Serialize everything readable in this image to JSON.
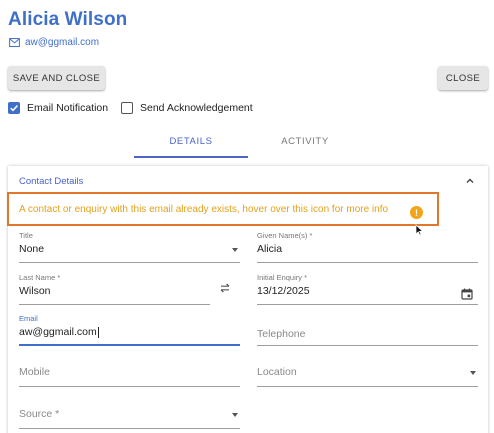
{
  "contact": {
    "name": "Alicia Wilson",
    "email": "aw@ggmail.com"
  },
  "toolbar": {
    "save_close_label": "SAVE AND CLOSE",
    "close_label": "CLOSE"
  },
  "options": {
    "email_notification_label": "Email Notification",
    "email_notification_checked": true,
    "send_ack_label": "Send Acknowledgement",
    "send_ack_checked": false
  },
  "tabs": [
    {
      "label": "DETAILS",
      "active": true
    },
    {
      "label": "ACTIVITY",
      "active": false
    }
  ],
  "section": {
    "title": "Contact Details",
    "warning": "A contact or enquiry with this email already exists, hover over this icon for more info",
    "warning_icon": "!"
  },
  "form": {
    "title": {
      "label": "Title",
      "value": "None"
    },
    "given_names": {
      "label": "Given Name(s) *",
      "value": "Alicia"
    },
    "last_name": {
      "label": "Last Name *",
      "value": "Wilson"
    },
    "initial_enquiry": {
      "label": "Initial Enquiry *",
      "value": "13/12/2025"
    },
    "email": {
      "label": "Email",
      "value": "aw@ggmail.com"
    },
    "telephone": {
      "placeholder": "Telephone"
    },
    "mobile": {
      "placeholder": "Mobile"
    },
    "location": {
      "placeholder": "Location"
    },
    "source": {
      "placeholder": "Source *"
    }
  },
  "colors": {
    "accent": "#3f6fc9",
    "warning_border": "#e0772b",
    "warning_text": "#e3a11f",
    "warning_icon": "#f2a516"
  }
}
